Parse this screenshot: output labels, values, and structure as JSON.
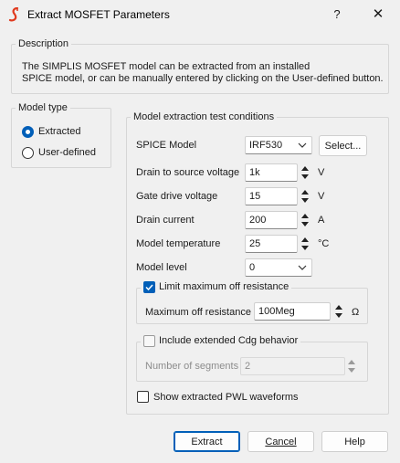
{
  "window": {
    "title": "Extract MOSFET Parameters",
    "help_glyph": "?",
    "close_glyph": "✕"
  },
  "description": {
    "label": "Description",
    "line1": "The SIMPLIS MOSFET model can be extracted from an installed",
    "line2": "SPICE model, or can be manually entered by clicking on the User-defined button."
  },
  "model_type": {
    "label": "Model type",
    "options": [
      {
        "label": "Extracted",
        "selected": true
      },
      {
        "label": "User-defined",
        "selected": false
      }
    ]
  },
  "conditions": {
    "label": "Model extraction test conditions",
    "spice_model": {
      "label": "SPICE Model",
      "value": "IRF530",
      "select_button": "Select..."
    },
    "drain_source_voltage": {
      "label": "Drain to source voltage",
      "value": "1k",
      "unit": "V"
    },
    "gate_drive_voltage": {
      "label": "Gate drive voltage",
      "value": "15",
      "unit": "V"
    },
    "drain_current": {
      "label": "Drain current",
      "value": "200",
      "unit": "A"
    },
    "model_temperature": {
      "label": "Model temperature",
      "value": "25",
      "unit": "°C"
    },
    "model_level": {
      "label": "Model level",
      "value": "0"
    },
    "limit_off_resistance": {
      "label": "Limit maximum off resistance",
      "checked": true,
      "field_label": "Maximum off resistance",
      "value": "100Meg",
      "unit": "Ω"
    },
    "extended_cdg": {
      "label": "Include extended Cdg behavior",
      "checked": false,
      "field_label": "Number of segments",
      "value": "2"
    },
    "show_pwl": {
      "label": "Show extracted PWL waveforms",
      "checked": false
    }
  },
  "buttons": {
    "extract": "Extract",
    "cancel": "Cancel",
    "help": "Help"
  },
  "colors": {
    "accent": "#005fb8",
    "app_icon": "#e03a1e"
  }
}
